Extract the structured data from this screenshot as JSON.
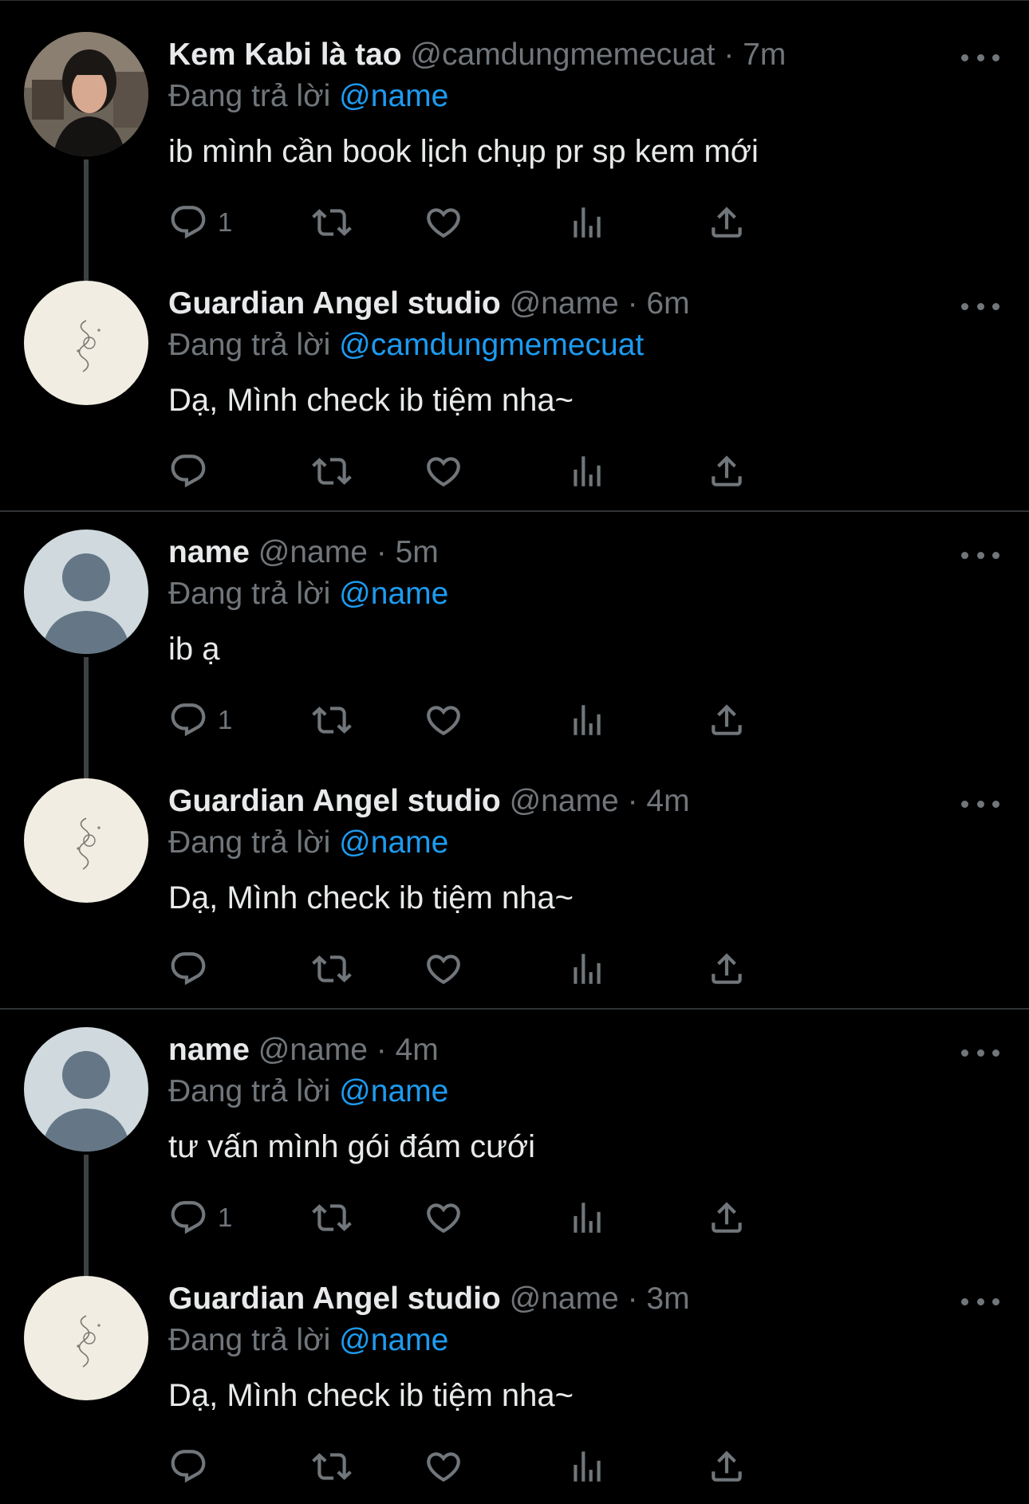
{
  "tweets": [
    {
      "display_name": "Kem Kabi là tao",
      "handle": "@camdungmemecuat",
      "time": "7m",
      "replying_label": "Đang trả lời",
      "mention": "@name",
      "text": "ib mình cần book lịch chụp pr sp kem mới",
      "reply_count": "1",
      "avatar": "photo-avatar"
    },
    {
      "display_name": "Guardian Angel studio",
      "handle": "@name",
      "time": "6m",
      "replying_label": "Đang trả lời",
      "mention": "@camdungmemecuat",
      "text": "Dạ, Mình check ib tiệm nha~",
      "reply_count": "",
      "avatar": "studio-logo-avatar"
    },
    {
      "display_name": "name",
      "handle": "@name",
      "time": "5m",
      "replying_label": "Đang trả lời",
      "mention": "@name",
      "text": "ib ạ",
      "reply_count": "1",
      "avatar": "default-avatar"
    },
    {
      "display_name": "Guardian Angel studio",
      "handle": "@name",
      "time": "4m",
      "replying_label": "Đang trả lời",
      "mention": "@name",
      "text": "Dạ, Mình check ib tiệm nha~",
      "reply_count": "",
      "avatar": "studio-logo-avatar"
    },
    {
      "display_name": "name",
      "handle": "@name",
      "time": "4m",
      "replying_label": "Đang trả lời",
      "mention": "@name",
      "text": "tư vấn mình gói đám cưới",
      "reply_count": "1",
      "avatar": "default-avatar"
    },
    {
      "display_name": "Guardian Angel studio",
      "handle": "@name",
      "time": "3m",
      "replying_label": "Đang trả lời",
      "mention": "@name",
      "text": "Dạ, Mình check ib tiệm nha~",
      "reply_count": "",
      "avatar": "studio-logo-avatar"
    }
  ],
  "separator": "·",
  "colors": {
    "background": "#000000",
    "text": "#e7e9ea",
    "muted": "#71767b",
    "link": "#1d9bf0",
    "divider": "#2f3336"
  }
}
